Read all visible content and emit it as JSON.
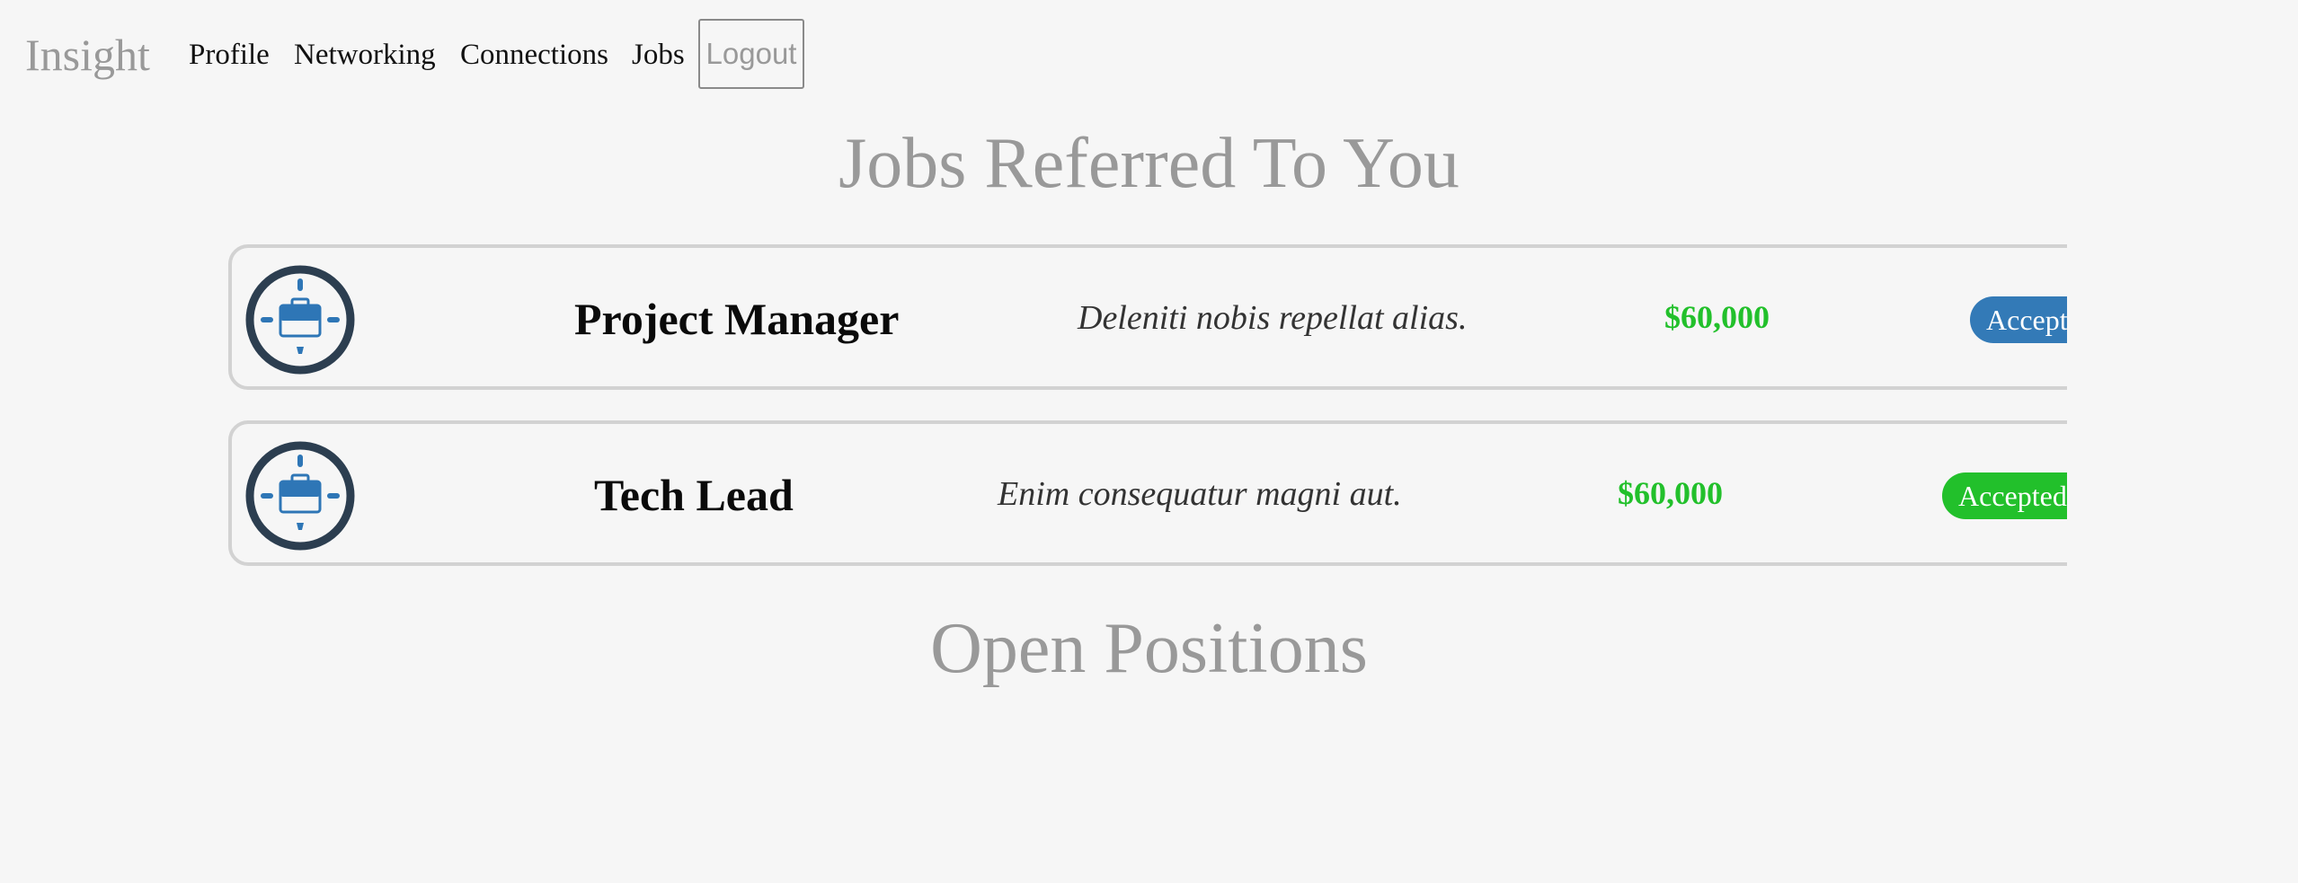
{
  "nav": {
    "brand": "Insight",
    "links": [
      "Profile",
      "Networking",
      "Connections",
      "Jobs"
    ],
    "logout": "Logout"
  },
  "referred": {
    "title": "Jobs Referred To You",
    "jobs": [
      {
        "title": "Project Manager",
        "description": "Deleniti nobis repellat alias.",
        "salary": "$60,000",
        "action": "Accept",
        "action_color": "#337ab7"
      },
      {
        "title": "Tech Lead",
        "description": "Enim consequatur magni aut.",
        "salary": "$60,000",
        "action": "Accepted",
        "action_color": "#22c02b"
      }
    ]
  },
  "open_positions": {
    "title": "Open Positions"
  },
  "icons": {
    "job_icon": "briefcase-compass-icon"
  },
  "colors": {
    "background": "#f6f6f6",
    "muted": "#999999",
    "salary": "#22c02b",
    "icon_ring": "#2c3e50",
    "icon_accent": "#2e76b6"
  }
}
